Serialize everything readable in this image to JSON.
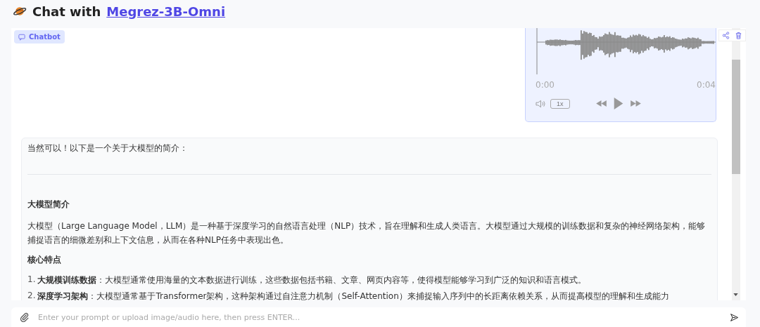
{
  "header": {
    "title": "Chat with",
    "link": "Megrez-3B-Omni"
  },
  "chatbot": {
    "label": "Chatbot"
  },
  "audio": {
    "time_start": "0:00",
    "time_end": "0:04",
    "speed": "1x"
  },
  "message": {
    "intro": "当然可以！以下是一个关于大模型的简介：",
    "blocks": [
      {
        "kind": "heading",
        "text": "大模型简介"
      },
      {
        "kind": "paragraph",
        "text": "大模型（Large Language Model，LLM）是一种基于深度学习的自然语言处理（NLP）技术，旨在理解和生成人类语言。大模型通过大规模的训练数据和复杂的神经网络架构，能够捕捉语言的细微差别和上下文信息，从而在各种NLP任务中表现出色。"
      },
      {
        "kind": "heading",
        "text": "核心特点"
      },
      {
        "kind": "list",
        "items": [
          {
            "number": "1.",
            "text": "**大规模训练数据**：大模型通常使用海量的文本数据进行训练，这些数据包括书籍、文章、网页内容等，使得模型能够学习到广泛的知识和语言模式。"
          },
          {
            "number": "2.",
            "text": "**深度学习架构**：大模型通常基于Transformer架构，这种架构通过自注意力机制（Self-Attention）来捕捉输入序列中的长距离依赖关系，从而提高模型的理解和生成能力"
          }
        ]
      }
    ]
  },
  "input": {
    "placeholder": "Enter your prompt or upload image/audio here, then press ENTER..."
  }
}
